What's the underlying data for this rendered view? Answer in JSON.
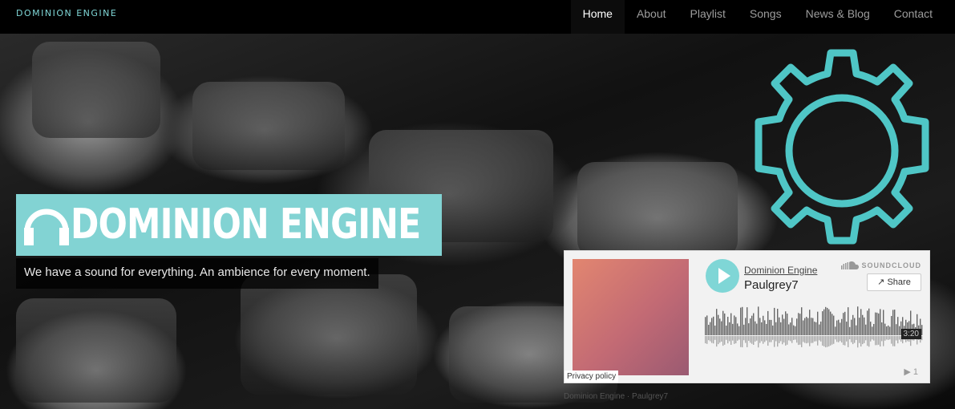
{
  "brand": "DOMINION ENGINE",
  "nav": [
    {
      "label": "Home",
      "active": true
    },
    {
      "label": "About"
    },
    {
      "label": "Playlist"
    },
    {
      "label": "Songs"
    },
    {
      "label": "News & Blog"
    },
    {
      "label": "Contact"
    }
  ],
  "hero": {
    "logo_text": "DOMINION ENGINE",
    "tagline": "We have a sound for everything. An ambience for every moment."
  },
  "soundcloud": {
    "artist": "Dominion Engine",
    "track": "Paulgrey7",
    "brand": "SOUNDCLOUD",
    "share_label": "Share",
    "duration": "3:20",
    "play_count": "1",
    "privacy": "Privacy policy",
    "credit": "Dominion Engine · Paulgrey7"
  },
  "colors": {
    "accent": "#7fd6d6",
    "navbar": "#000000"
  }
}
